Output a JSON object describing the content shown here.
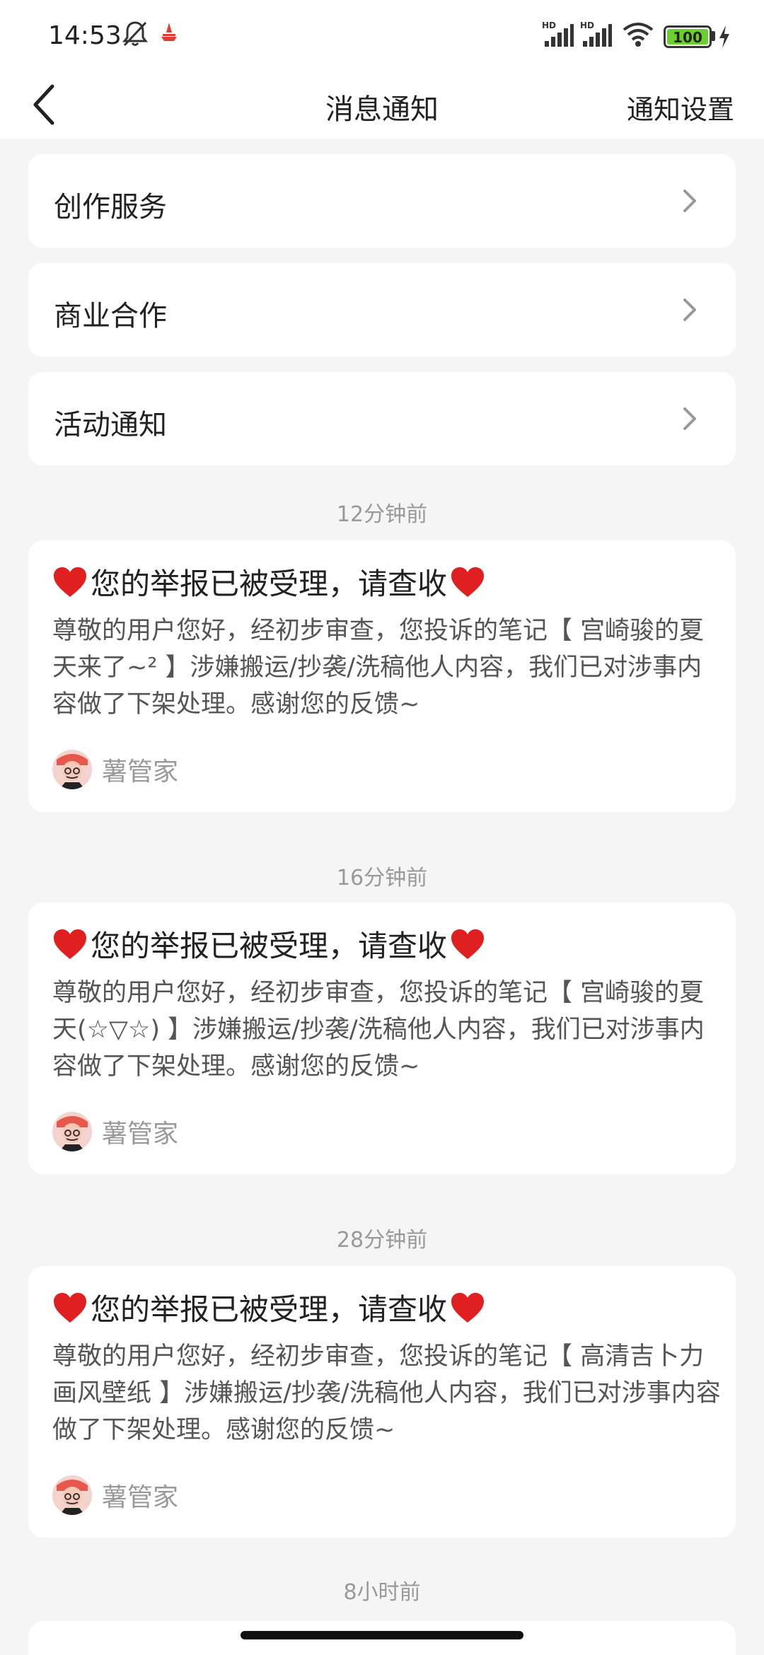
{
  "status_bar": {
    "time": "14:53",
    "battery": "100",
    "icons": [
      "mute-bell-icon",
      "app-notification-icon",
      "hd-signal-icon",
      "hd-signal-icon",
      "wifi-icon",
      "battery-icon",
      "charging-icon"
    ]
  },
  "nav": {
    "title": "消息通知",
    "settings": "通知设置"
  },
  "menu": [
    {
      "label": "创作服务"
    },
    {
      "label": "商业合作"
    },
    {
      "label": "活动通知"
    }
  ],
  "messages": [
    {
      "time": "12分钟前",
      "title": "您的举报已被受理，请查收",
      "body": "尊敬的用户您好，经初步审查，您投诉的笔记【 宫崎骏的夏天来了~² 】涉嫌搬运/抄袭/洗稿他人内容，我们已对涉事内容做了下架处理。感谢您的反馈~",
      "sender": "薯管家"
    },
    {
      "time": "16分钟前",
      "title": "您的举报已被受理，请查收",
      "body": "尊敬的用户您好，经初步审查，您投诉的笔记【 宫崎骏的夏天(☆▽☆) 】涉嫌搬运/抄袭/洗稿他人内容，我们已对涉事内容做了下架处理。感谢您的反馈~",
      "sender": "薯管家"
    },
    {
      "time": "28分钟前",
      "title": "您的举报已被受理，请查收",
      "body": "尊敬的用户您好，经初步审查，您投诉的笔记【 高清吉卜力画风壁纸 】涉嫌搬运/抄袭/洗稿他人内容，我们已对涉事内容做了下架处理。感谢您的反馈~",
      "sender": "薯管家"
    }
  ],
  "next_timestamp": "8小时前",
  "colors": {
    "heart": "#e02020",
    "battery": "#6ccf2f",
    "background": "#f5f5f5"
  }
}
